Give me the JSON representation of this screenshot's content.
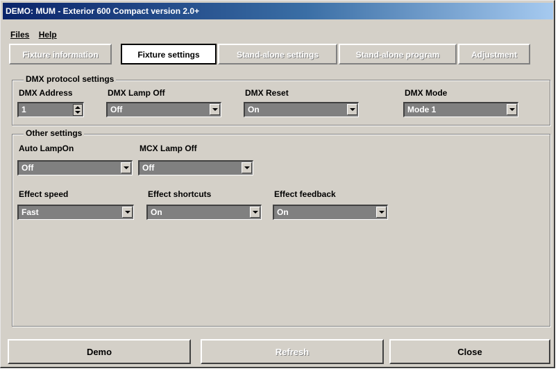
{
  "window": {
    "title": "DEMO: MUM - Exterior 600 Compact version 2.0+"
  },
  "menu": {
    "files": "Files",
    "help": "Help"
  },
  "tabs": [
    {
      "label": "Fixture information",
      "state": "disabled"
    },
    {
      "label": "Fixture settings",
      "state": "active"
    },
    {
      "label": "Stand-alone settings",
      "state": "disabled"
    },
    {
      "label": "Stand-alone program",
      "state": "disabled"
    },
    {
      "label": "Adjustment",
      "state": "disabled"
    }
  ],
  "dmx": {
    "title": "DMX protocol settings",
    "address_label": "DMX Address",
    "address_value": "1",
    "lamp_off_label": "DMX Lamp Off",
    "lamp_off_value": "Off",
    "reset_label": "DMX Reset",
    "reset_value": "On",
    "mode_label": "DMX Mode",
    "mode_value": "Mode 1"
  },
  "other": {
    "title": "Other settings",
    "auto_lamp_label": "Auto LampOn",
    "auto_lamp_value": "Off",
    "mcx_label": "MCX Lamp Off",
    "mcx_value": "Off",
    "speed_label": "Effect speed",
    "speed_value": "Fast",
    "shortcuts_label": "Effect shortcuts",
    "shortcuts_value": "On",
    "feedback_label": "Effect feedback",
    "feedback_value": "On"
  },
  "buttons": {
    "demo": "Demo",
    "refresh": "Refresh",
    "close": "Close"
  }
}
